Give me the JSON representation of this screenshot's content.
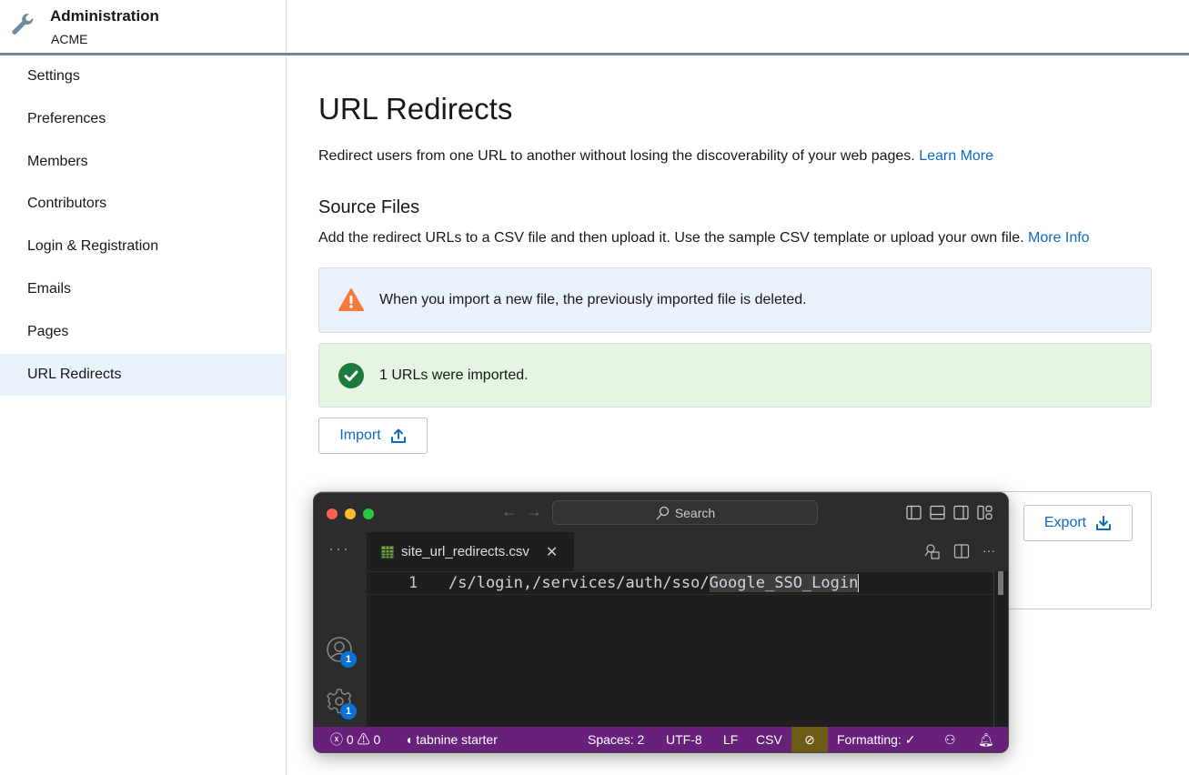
{
  "header": {
    "title": "Administration",
    "org": "ACME",
    "icon": "wrench-icon"
  },
  "sidebar": {
    "items": [
      {
        "label": "Settings",
        "active": false
      },
      {
        "label": "Preferences",
        "active": false
      },
      {
        "label": "Members",
        "active": false
      },
      {
        "label": "Contributors",
        "active": false
      },
      {
        "label": "Login & Registration",
        "active": false
      },
      {
        "label": "Emails",
        "active": false
      },
      {
        "label": "Pages",
        "active": false
      },
      {
        "label": "URL Redirects",
        "active": true
      }
    ]
  },
  "main": {
    "title": "URL Redirects",
    "description": "Redirect users from one URL to another without losing the discoverability of your web pages.",
    "learn_more": "Learn More",
    "section_title": "Source Files",
    "section_description": "Add the redirect URLs to a CSV file and then upload it. Use the sample CSV template or upload your own file.",
    "more_info": "More Info",
    "warning_alert": "When you import a new file, the previously imported file is deleted.",
    "success_alert": "1 URLs were imported.",
    "import_label": "Import",
    "export_label": "Export"
  },
  "colors": {
    "link": "#0b6ac4",
    "warning": "#f5793a",
    "success": "#1e7a3c",
    "statusbar": "#68217a"
  },
  "editor_window": {
    "search_label": "Search",
    "tab_filename": "site_url_redirects.csv",
    "line_number": "1",
    "code_plain": "/s/login,/services/auth/sso/",
    "code_selected": "Google_SSO_Login",
    "account_badge": "1",
    "settings_badge": "1",
    "status": {
      "errors": "0",
      "warnings": "0",
      "tabnine": "tabnine starter",
      "spaces": "Spaces: 2",
      "encoding": "UTF-8",
      "eol": "LF",
      "language": "CSV",
      "formatting": "Formatting: ✓"
    }
  }
}
